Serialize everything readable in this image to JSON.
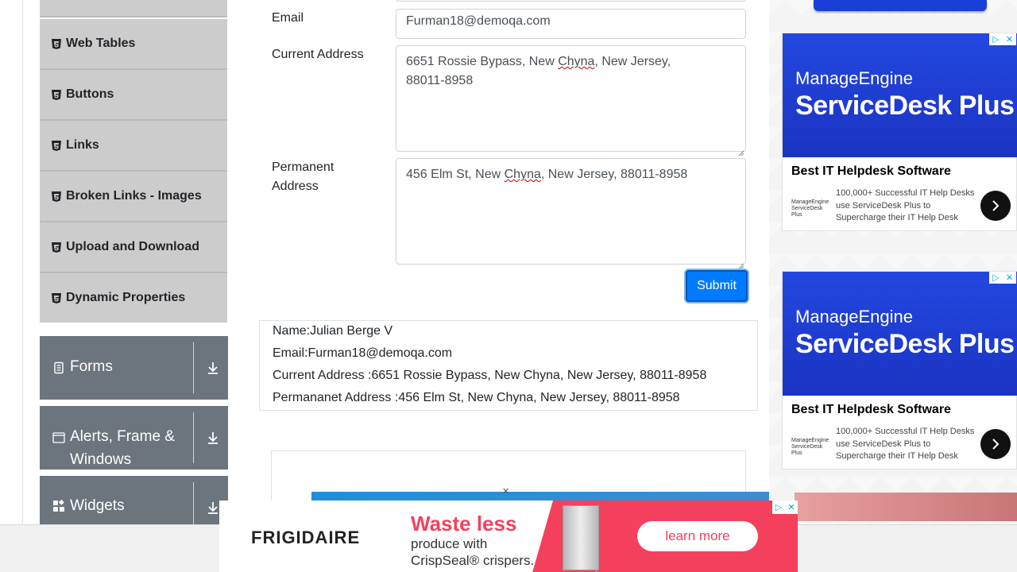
{
  "sidebar": {
    "elements_items": [
      {
        "label": ""
      },
      {
        "label": "Web Tables"
      },
      {
        "label": "Buttons"
      },
      {
        "label": "Links"
      },
      {
        "label": "Broken Links - Images"
      },
      {
        "label": "Upload and Download"
      },
      {
        "label": "Dynamic Properties"
      }
    ],
    "groups": [
      {
        "label": "Forms",
        "icon": "document-icon"
      },
      {
        "label": "Alerts, Frame & Windows",
        "icon": "window-icon"
      },
      {
        "label": "Widgets",
        "icon": "widgets-icon"
      }
    ]
  },
  "form": {
    "email_label": "Email",
    "email_value": "Furman18@demoqa.com",
    "current_address_label": "Current Address",
    "current_address_parts": [
      "6651 Rossie Bypass, New ",
      "Chyna",
      ", New Jersey,",
      "88011-8958"
    ],
    "permanent_address_label": "Permanent Address",
    "permanent_address_parts": [
      "456 Elm St, New ",
      "Chyna",
      ", New Jersey, 88011-8958"
    ],
    "submit_label": "Submit"
  },
  "output": {
    "name": "Name:Julian Berge V",
    "email": "Email:Furman18@demoqa.com",
    "current_address": "Current Address :6651 Rossie Bypass, New Chyna, New Jersey, 88011-8958",
    "permanent_address": "Permananet Address :456 Elm St, New Chyna, New Jersey, 88011-8958"
  },
  "ads": {
    "right": [
      {
        "brand": "ManageEngine",
        "product": "ServiceDesk Plus",
        "headline": "Best IT Helpdesk Software",
        "description": "100,000+ Successful IT Help Desks use ServiceDesk Plus to Supercharge their IT Help Desk",
        "small_logo": "ManageEngine ServiceDesk Plus"
      },
      {
        "brand": "ManageEngine",
        "product": "ServiceDesk Plus",
        "headline": "Best IT Helpdesk Software",
        "description": "100,000+ Successful IT Help Desks use ServiceDesk Plus to Supercharge their IT Help Desk",
        "small_logo": "ManageEngine ServiceDesk Plus"
      }
    ],
    "bottom": {
      "logo": "FRIGIDAIRE",
      "headline": "Waste less",
      "tagline_line1": "produce with",
      "tagline_line2": "CrispSeal® crispers.",
      "cta": "learn more"
    }
  },
  "colors": {
    "primary": "#007bff",
    "sidebar_item_bg": "#cccccc",
    "group_bg": "#6c757d",
    "ad_blue": "#2247e0",
    "ad_pink": "#f4405c"
  }
}
